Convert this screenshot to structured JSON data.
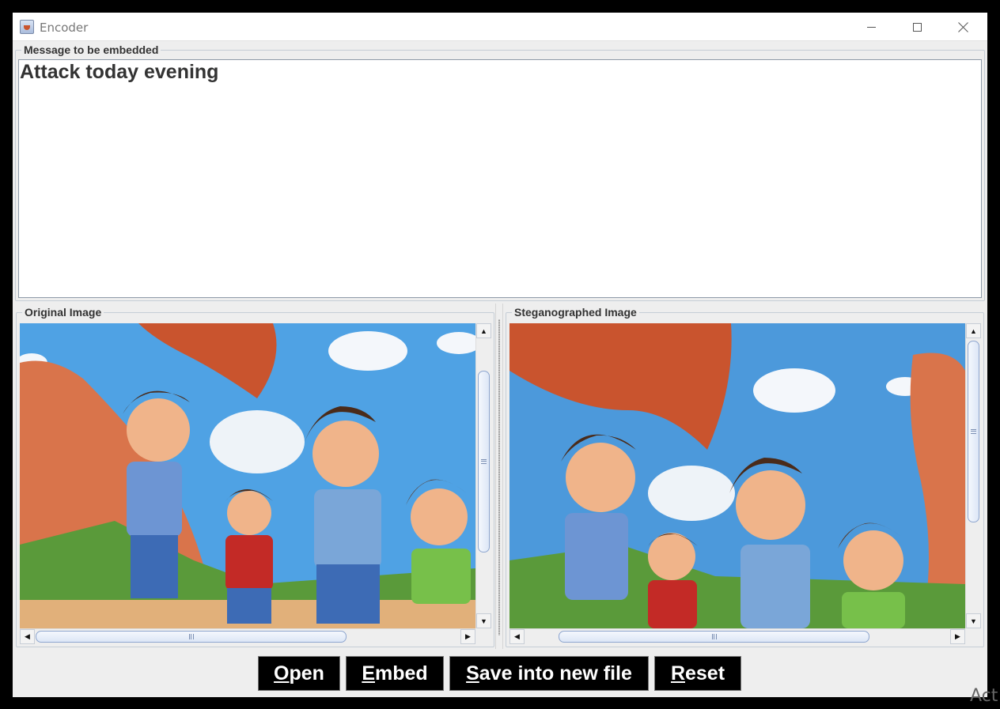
{
  "window": {
    "title": "Encoder",
    "controls": [
      "minimize-icon",
      "maximize-icon",
      "close-icon"
    ]
  },
  "message_panel": {
    "label": "Message to be embedded",
    "text": "Attack today evening"
  },
  "original_panel": {
    "label": "Original Image",
    "image": "cartoon boys in desert canyon"
  },
  "stego_panel": {
    "label": "Steganographed Image",
    "image": "cartoon boys in desert canyon"
  },
  "buttons": {
    "open": {
      "mnemonic": "O",
      "rest": "pen"
    },
    "embed": {
      "mnemonic": "E",
      "rest": "mbed"
    },
    "save": {
      "mnemonic": "S",
      "rest": "ave into new file"
    },
    "reset": {
      "mnemonic": "R",
      "rest": "eset"
    }
  },
  "watermark": "Act",
  "colors": {
    "button_bg": "#000000",
    "button_fg": "#ffffff",
    "panel_bg": "#eeeeee",
    "sky": "#5aa8e6",
    "rock": "#c9542e"
  }
}
